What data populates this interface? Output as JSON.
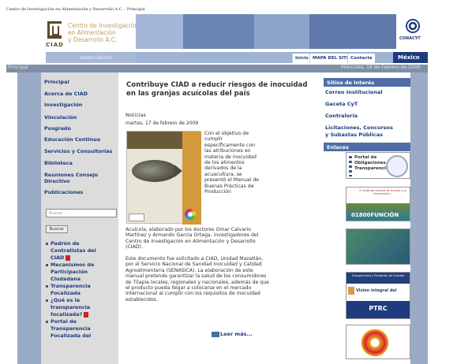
{
  "window_title": "Centro de Investigación en Alimentación y Desarrollo A.C. - Principal",
  "header": {
    "logo_text_line1": "Centro de Investigación",
    "logo_text_line2": "en Alimentación",
    "logo_text_line3": "y Desarrollo A.C.",
    "ciad_label": "CIAD",
    "url_text": "www.ciad.mx",
    "conacyt_label": "CONACYT",
    "nav": {
      "inicio": "Inicio",
      "mapa": "MAPA DEL SITIO",
      "contacto": "Contacte",
      "mexico": "México"
    }
  },
  "breadcrumb": "Principal",
  "date_text": "Miércoles, 18 de Febrero de 2009",
  "left_nav": [
    "Principal",
    "Acerca de CIAD",
    "Investigación",
    "Vinculación",
    "Posgrado",
    "Educación Continua",
    "Servicios y Consultorías",
    "Biblioteca",
    "Reuniones Consejo",
    "Directivo",
    "Publicaciones"
  ],
  "search": {
    "placeholder": "Buscar...",
    "button": "Buscar"
  },
  "sub_links": [
    "Padrón de",
    "Contratistas del",
    "CIAD",
    "Mecanismos de",
    "Participación",
    "Ciudadana",
    "Transparencia",
    "Focalizada",
    "¿Qué es la",
    "transparencia",
    "focalizada?",
    "Portal de",
    "Transparencia",
    "Focalizada del"
  ],
  "article": {
    "title": "Contribuye CIAD a reducir riesgos de inocuidad en las granjas acuícolas del país",
    "category": "Noticias",
    "date": "martes, 17 de febrero de 2009",
    "side_text": "Con el objetivo de cumplir específicamente con las atribuciones en materia de inocuidad de los alimentos derivados de la acuacultura, se presentó el Manual de Buenas Prácticas de Producción",
    "body1": "Acuícola, elaborado por los doctores Omar Calvario Martínez y Armando García Ortega, investigadores del Centro de Investigación en Alimentación y Desarrollo (CIAD).",
    "body2": "Este documento fue solicitado a CIAD, Unidad Mazatlán, por el Servicio Nacional de Sanidad Inocuidad y Calidad Agroalimentaria (SENASICA). La elaboración de este manual pretende garantizar la salud de los consumidores de Tilapia locales, regionales y nacionales, además de que el producto pueda llegar a colocarse en el mercado internacional al cumplir con los requisitos de inocuidad establecidos.",
    "read_more": "Leer más..."
  },
  "right": {
    "sitios_heading": "Sitios de Interés",
    "sitios": [
      "Correo Institucional",
      "Gaceta CyT",
      "Contraloría",
      "Licitaciones, Concursos",
      "y Subastas Públicas"
    ],
    "enlaces_heading": "Enlaces",
    "portal_text_1": "Portal de",
    "portal_text_2": "Obligaciones de",
    "portal_text_3": "Transparencia",
    "fun_small": "El Instituto Federal de Acceso a la Información...",
    "fun_big": "01800FUNCIÓN",
    "green_text": "",
    "trans_head": "Transparencia y Rendición de Cuentas",
    "vision_text": "Visión integral del",
    "ptrc": "PTRC"
  }
}
